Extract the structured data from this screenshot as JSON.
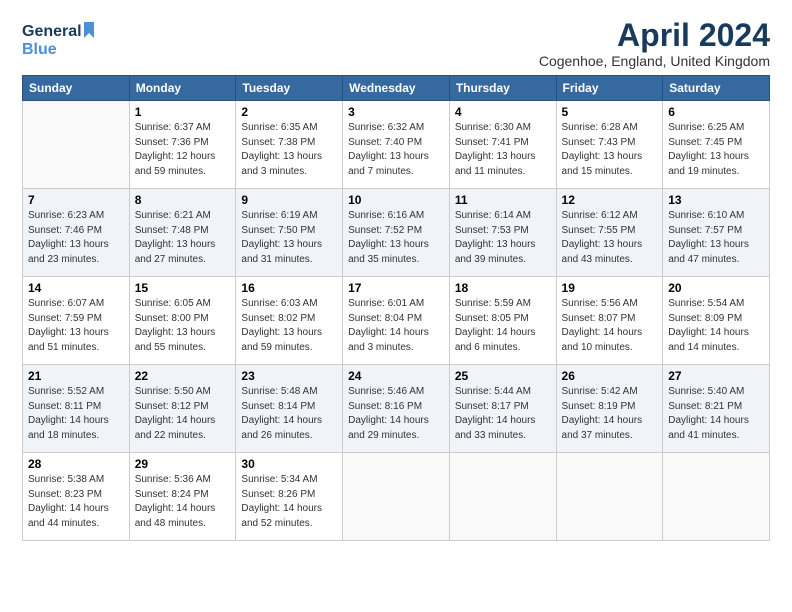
{
  "logo": {
    "line1": "General",
    "line2": "Blue"
  },
  "title": "April 2024",
  "location": "Cogenhoe, England, United Kingdom",
  "weekdays": [
    "Sunday",
    "Monday",
    "Tuesday",
    "Wednesday",
    "Thursday",
    "Friday",
    "Saturday"
  ],
  "weeks": [
    [
      {
        "day": "",
        "info": ""
      },
      {
        "day": "1",
        "info": "Sunrise: 6:37 AM\nSunset: 7:36 PM\nDaylight: 12 hours\nand 59 minutes."
      },
      {
        "day": "2",
        "info": "Sunrise: 6:35 AM\nSunset: 7:38 PM\nDaylight: 13 hours\nand 3 minutes."
      },
      {
        "day": "3",
        "info": "Sunrise: 6:32 AM\nSunset: 7:40 PM\nDaylight: 13 hours\nand 7 minutes."
      },
      {
        "day": "4",
        "info": "Sunrise: 6:30 AM\nSunset: 7:41 PM\nDaylight: 13 hours\nand 11 minutes."
      },
      {
        "day": "5",
        "info": "Sunrise: 6:28 AM\nSunset: 7:43 PM\nDaylight: 13 hours\nand 15 minutes."
      },
      {
        "day": "6",
        "info": "Sunrise: 6:25 AM\nSunset: 7:45 PM\nDaylight: 13 hours\nand 19 minutes."
      }
    ],
    [
      {
        "day": "7",
        "info": "Sunrise: 6:23 AM\nSunset: 7:46 PM\nDaylight: 13 hours\nand 23 minutes."
      },
      {
        "day": "8",
        "info": "Sunrise: 6:21 AM\nSunset: 7:48 PM\nDaylight: 13 hours\nand 27 minutes."
      },
      {
        "day": "9",
        "info": "Sunrise: 6:19 AM\nSunset: 7:50 PM\nDaylight: 13 hours\nand 31 minutes."
      },
      {
        "day": "10",
        "info": "Sunrise: 6:16 AM\nSunset: 7:52 PM\nDaylight: 13 hours\nand 35 minutes."
      },
      {
        "day": "11",
        "info": "Sunrise: 6:14 AM\nSunset: 7:53 PM\nDaylight: 13 hours\nand 39 minutes."
      },
      {
        "day": "12",
        "info": "Sunrise: 6:12 AM\nSunset: 7:55 PM\nDaylight: 13 hours\nand 43 minutes."
      },
      {
        "day": "13",
        "info": "Sunrise: 6:10 AM\nSunset: 7:57 PM\nDaylight: 13 hours\nand 47 minutes."
      }
    ],
    [
      {
        "day": "14",
        "info": "Sunrise: 6:07 AM\nSunset: 7:59 PM\nDaylight: 13 hours\nand 51 minutes."
      },
      {
        "day": "15",
        "info": "Sunrise: 6:05 AM\nSunset: 8:00 PM\nDaylight: 13 hours\nand 55 minutes."
      },
      {
        "day": "16",
        "info": "Sunrise: 6:03 AM\nSunset: 8:02 PM\nDaylight: 13 hours\nand 59 minutes."
      },
      {
        "day": "17",
        "info": "Sunrise: 6:01 AM\nSunset: 8:04 PM\nDaylight: 14 hours\nand 3 minutes."
      },
      {
        "day": "18",
        "info": "Sunrise: 5:59 AM\nSunset: 8:05 PM\nDaylight: 14 hours\nand 6 minutes."
      },
      {
        "day": "19",
        "info": "Sunrise: 5:56 AM\nSunset: 8:07 PM\nDaylight: 14 hours\nand 10 minutes."
      },
      {
        "day": "20",
        "info": "Sunrise: 5:54 AM\nSunset: 8:09 PM\nDaylight: 14 hours\nand 14 minutes."
      }
    ],
    [
      {
        "day": "21",
        "info": "Sunrise: 5:52 AM\nSunset: 8:11 PM\nDaylight: 14 hours\nand 18 minutes."
      },
      {
        "day": "22",
        "info": "Sunrise: 5:50 AM\nSunset: 8:12 PM\nDaylight: 14 hours\nand 22 minutes."
      },
      {
        "day": "23",
        "info": "Sunrise: 5:48 AM\nSunset: 8:14 PM\nDaylight: 14 hours\nand 26 minutes."
      },
      {
        "day": "24",
        "info": "Sunrise: 5:46 AM\nSunset: 8:16 PM\nDaylight: 14 hours\nand 29 minutes."
      },
      {
        "day": "25",
        "info": "Sunrise: 5:44 AM\nSunset: 8:17 PM\nDaylight: 14 hours\nand 33 minutes."
      },
      {
        "day": "26",
        "info": "Sunrise: 5:42 AM\nSunset: 8:19 PM\nDaylight: 14 hours\nand 37 minutes."
      },
      {
        "day": "27",
        "info": "Sunrise: 5:40 AM\nSunset: 8:21 PM\nDaylight: 14 hours\nand 41 minutes."
      }
    ],
    [
      {
        "day": "28",
        "info": "Sunrise: 5:38 AM\nSunset: 8:23 PM\nDaylight: 14 hours\nand 44 minutes."
      },
      {
        "day": "29",
        "info": "Sunrise: 5:36 AM\nSunset: 8:24 PM\nDaylight: 14 hours\nand 48 minutes."
      },
      {
        "day": "30",
        "info": "Sunrise: 5:34 AM\nSunset: 8:26 PM\nDaylight: 14 hours\nand 52 minutes."
      },
      {
        "day": "",
        "info": ""
      },
      {
        "day": "",
        "info": ""
      },
      {
        "day": "",
        "info": ""
      },
      {
        "day": "",
        "info": ""
      }
    ]
  ]
}
